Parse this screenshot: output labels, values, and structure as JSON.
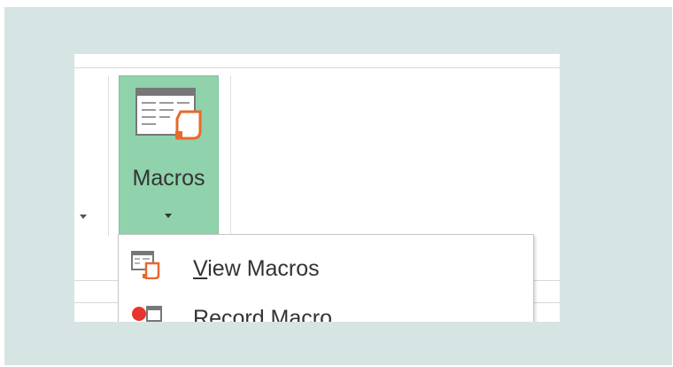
{
  "ribbon": {
    "macros_button": {
      "label": "Macros",
      "icon": "macros-icon",
      "accent_color": "#8fd2ab"
    }
  },
  "menu": {
    "items": [
      {
        "label": "View Macros",
        "icon": "view-macros-icon",
        "accelerator": "V"
      },
      {
        "label": "Record Macro",
        "icon": "record-macro-icon",
        "accelerator": "R"
      }
    ]
  },
  "colors": {
    "background": "#d6e5e4",
    "icon_orange": "#e8692c",
    "record_red": "#e8342c"
  }
}
